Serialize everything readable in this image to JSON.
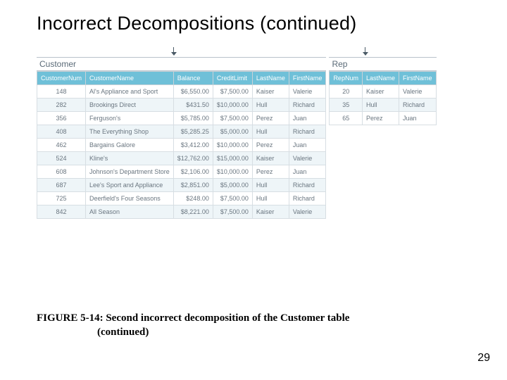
{
  "title": "Incorrect Decompositions (continued)",
  "customer": {
    "label": "Customer",
    "headers": [
      "CustomerNum",
      "CustomerName",
      "Balance",
      "CreditLimit",
      "LastName",
      "FirstName"
    ],
    "rows": [
      [
        "148",
        "Al's Appliance and Sport",
        "$6,550.00",
        "$7,500.00",
        "Kaiser",
        "Valerie"
      ],
      [
        "282",
        "Brookings Direct",
        "$431.50",
        "$10,000.00",
        "Hull",
        "Richard"
      ],
      [
        "356",
        "Ferguson's",
        "$5,785.00",
        "$7,500.00",
        "Perez",
        "Juan"
      ],
      [
        "408",
        "The Everything Shop",
        "$5,285.25",
        "$5,000.00",
        "Hull",
        "Richard"
      ],
      [
        "462",
        "Bargains Galore",
        "$3,412.00",
        "$10,000.00",
        "Perez",
        "Juan"
      ],
      [
        "524",
        "Kline's",
        "$12,762.00",
        "$15,000.00",
        "Kaiser",
        "Valerie"
      ],
      [
        "608",
        "Johnson's Department Store",
        "$2,106.00",
        "$10,000.00",
        "Perez",
        "Juan"
      ],
      [
        "687",
        "Lee's Sport and Appliance",
        "$2,851.00",
        "$5,000.00",
        "Hull",
        "Richard"
      ],
      [
        "725",
        "Deerfield's Four Seasons",
        "$248.00",
        "$7,500.00",
        "Hull",
        "Richard"
      ],
      [
        "842",
        "All Season",
        "$8,221.00",
        "$7,500.00",
        "Kaiser",
        "Valerie"
      ]
    ]
  },
  "rep": {
    "label": "Rep",
    "headers": [
      "RepNum",
      "LastName",
      "FirstName"
    ],
    "rows": [
      [
        "20",
        "Kaiser",
        "Valerie"
      ],
      [
        "35",
        "Hull",
        "Richard"
      ],
      [
        "65",
        "Perez",
        "Juan"
      ]
    ]
  },
  "caption": {
    "lead": "FIGURE 5-14: Second incorrect decomposition of the Customer table",
    "cont": "(continued)"
  },
  "page_number": "29"
}
